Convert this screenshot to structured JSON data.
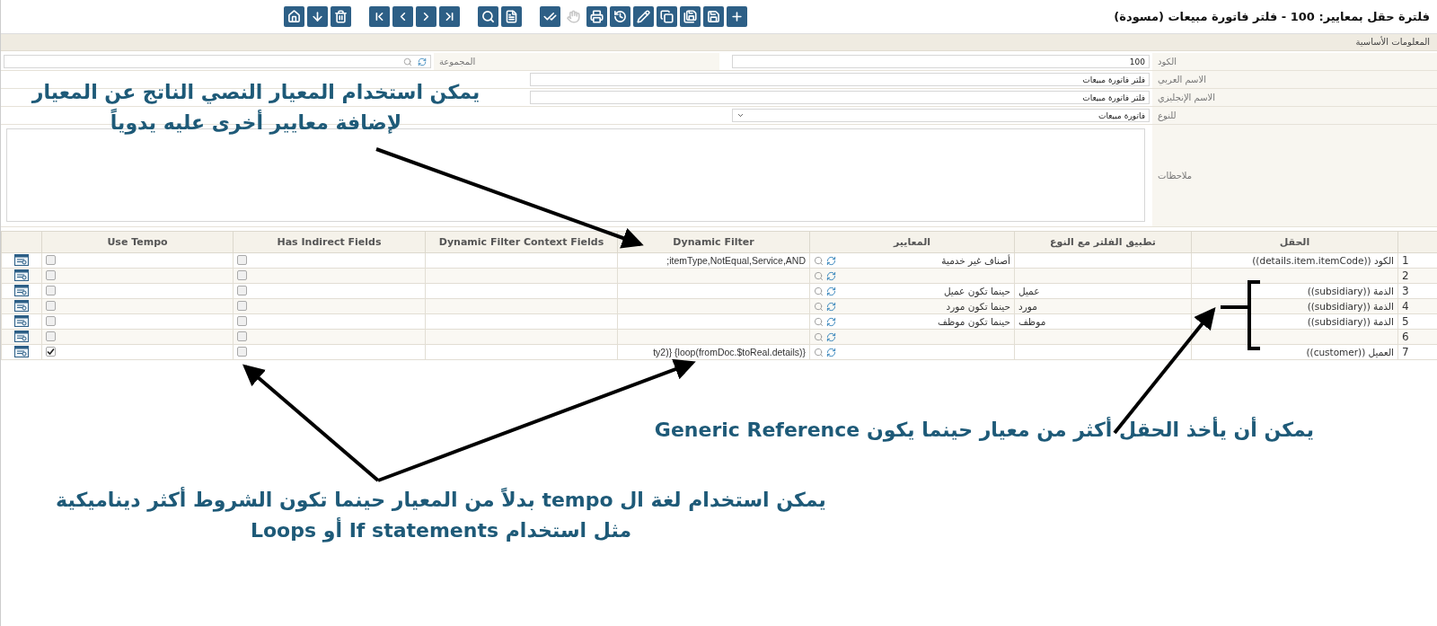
{
  "title": "فلترة حقل بمعايير: 100 - فلتر فاتورة مبيعات (مسودة)",
  "toolbar_groups": [
    [
      {
        "kind": "add",
        "disabled": false
      },
      {
        "kind": "save",
        "disabled": false
      },
      {
        "kind": "save_as",
        "disabled": false
      },
      {
        "kind": "copy",
        "disabled": false
      },
      {
        "kind": "edit",
        "disabled": false
      },
      {
        "kind": "history",
        "disabled": false
      },
      {
        "kind": "print",
        "disabled": false
      },
      {
        "kind": "hand",
        "disabled": true
      },
      {
        "kind": "approve",
        "disabled": false
      }
    ],
    [
      {
        "kind": "document",
        "disabled": false
      },
      {
        "kind": "find",
        "disabled": false
      }
    ],
    [
      {
        "kind": "last",
        "disabled": false
      },
      {
        "kind": "next",
        "disabled": false
      },
      {
        "kind": "previous",
        "disabled": false
      },
      {
        "kind": "first",
        "disabled": false
      }
    ],
    [
      {
        "kind": "delete",
        "disabled": false
      },
      {
        "kind": "download",
        "disabled": false
      },
      {
        "kind": "home",
        "disabled": false
      }
    ]
  ],
  "section_title": "المعلومات الأساسية",
  "form": {
    "code_label": "الكود",
    "code_value": "100",
    "group_label": "المجموعة",
    "arabic_name_label": "الاسم العربي",
    "arabic_name_value": "فلتر فاتورة مبيعات",
    "english_name_label": "الاسم الإنجليزي",
    "english_name_value": "فلتر فاتورة مبيعات",
    "type_label": "للنوع",
    "type_value": "فاتورة مبيعات",
    "notes_label": "ملاحظات"
  },
  "grid": {
    "columns": [
      "الحقل",
      "تطبيق الفلتر مع النوع",
      "المعايير",
      "Dynamic Filter",
      "Dynamic Filter Context Fields",
      "Has Indirect Fields",
      "Use Tempo"
    ],
    "rows": [
      {
        "number": "1",
        "field": "الكود ((details.item.itemCode))",
        "criteria": "أصناف غير خدمية",
        "dynamic_filter": ";itemType,NotEqual,Service,AND",
        "has_indirect_fields": false,
        "use_tempo": false
      },
      {
        "number": "2",
        "has_indirect_fields": false,
        "use_tempo": false
      },
      {
        "number": "3",
        "field": "الذمة ((subsidiary))",
        "apply_to_type": "عميل",
        "criteria": "حينما تكون عميل",
        "has_indirect_fields": false,
        "use_tempo": false
      },
      {
        "number": "4",
        "field": "الذمة ((subsidiary))",
        "apply_to_type": "مورد",
        "criteria": "حينما تكون مورد",
        "has_indirect_fields": false,
        "use_tempo": false
      },
      {
        "number": "5",
        "field": "الذمة ((subsidiary))",
        "apply_to_type": "موظف",
        "criteria": "حينما تكون موظف",
        "has_indirect_fields": false,
        "use_tempo": false
      },
      {
        "number": "6",
        "has_indirect_fields": false,
        "use_tempo": false
      },
      {
        "number": "7",
        "field": "العميل ((customer))",
        "dynamic_filter": "ty2)} {loop(fromDoc.$toReal.details)}",
        "has_indirect_fields": false,
        "use_tempo": true
      }
    ]
  },
  "annotations": [
    {
      "lines": [
        "يمكن استخدام المعيار النصي الناتج عن المعيار",
        "لإضافة معايير أخرى عليه يدوياً"
      ]
    },
    {
      "lines": [
        "يمكن أن يأخذ الحقل أكثر من معيار حينما يكون Generic Reference"
      ]
    },
    {
      "lines": [
        "يمكن استخدام لغة ال tempo بدلاً من المعيار حينما تكون الشروط أكثر ديناميكية",
        "مثل استخدام If statements أو Loops"
      ]
    }
  ]
}
